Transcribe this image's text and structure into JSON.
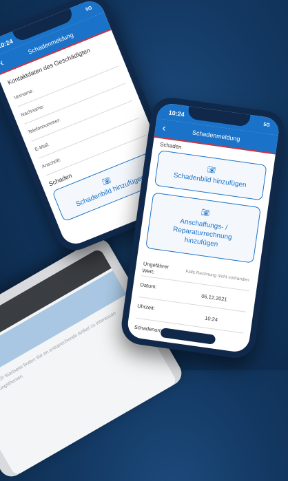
{
  "status": {
    "time": "10:24",
    "signal": "5G"
  },
  "phone1": {
    "title": "Schadenmeldung",
    "section": "Kontaktdaten des Geschädigten",
    "fields": [
      "Vorname:",
      "Nachname:",
      "Telefonnummer:",
      "E-Mail:",
      "Anschrift:"
    ],
    "damage_section": "Schaden",
    "card_label": "Schadenbild hinzufügen"
  },
  "phone2": {
    "title": "Schadenmeldung",
    "section": "Schaden",
    "card1": "Schadenbild hinzufügen",
    "card2": "Anschaffungs- / Reparaturrechnung hinzufügen",
    "value_label": "Ungefährer Wert:",
    "value_placeholder": "Falls Rechnung nicht vorhanden",
    "date_label": "Datum:",
    "date_value": "06.12.2021",
    "time_label": "Uhrzeit:",
    "time_value": "10:24",
    "place_label": "Schadenort:"
  },
  "paper": {
    "text": "HELMSAUER Startseite finden Sie en entsprechende Artikel zu interessan Versicherungsthemen"
  },
  "icons": {
    "camera": "camera-icon",
    "back": "back-arrow-icon"
  }
}
